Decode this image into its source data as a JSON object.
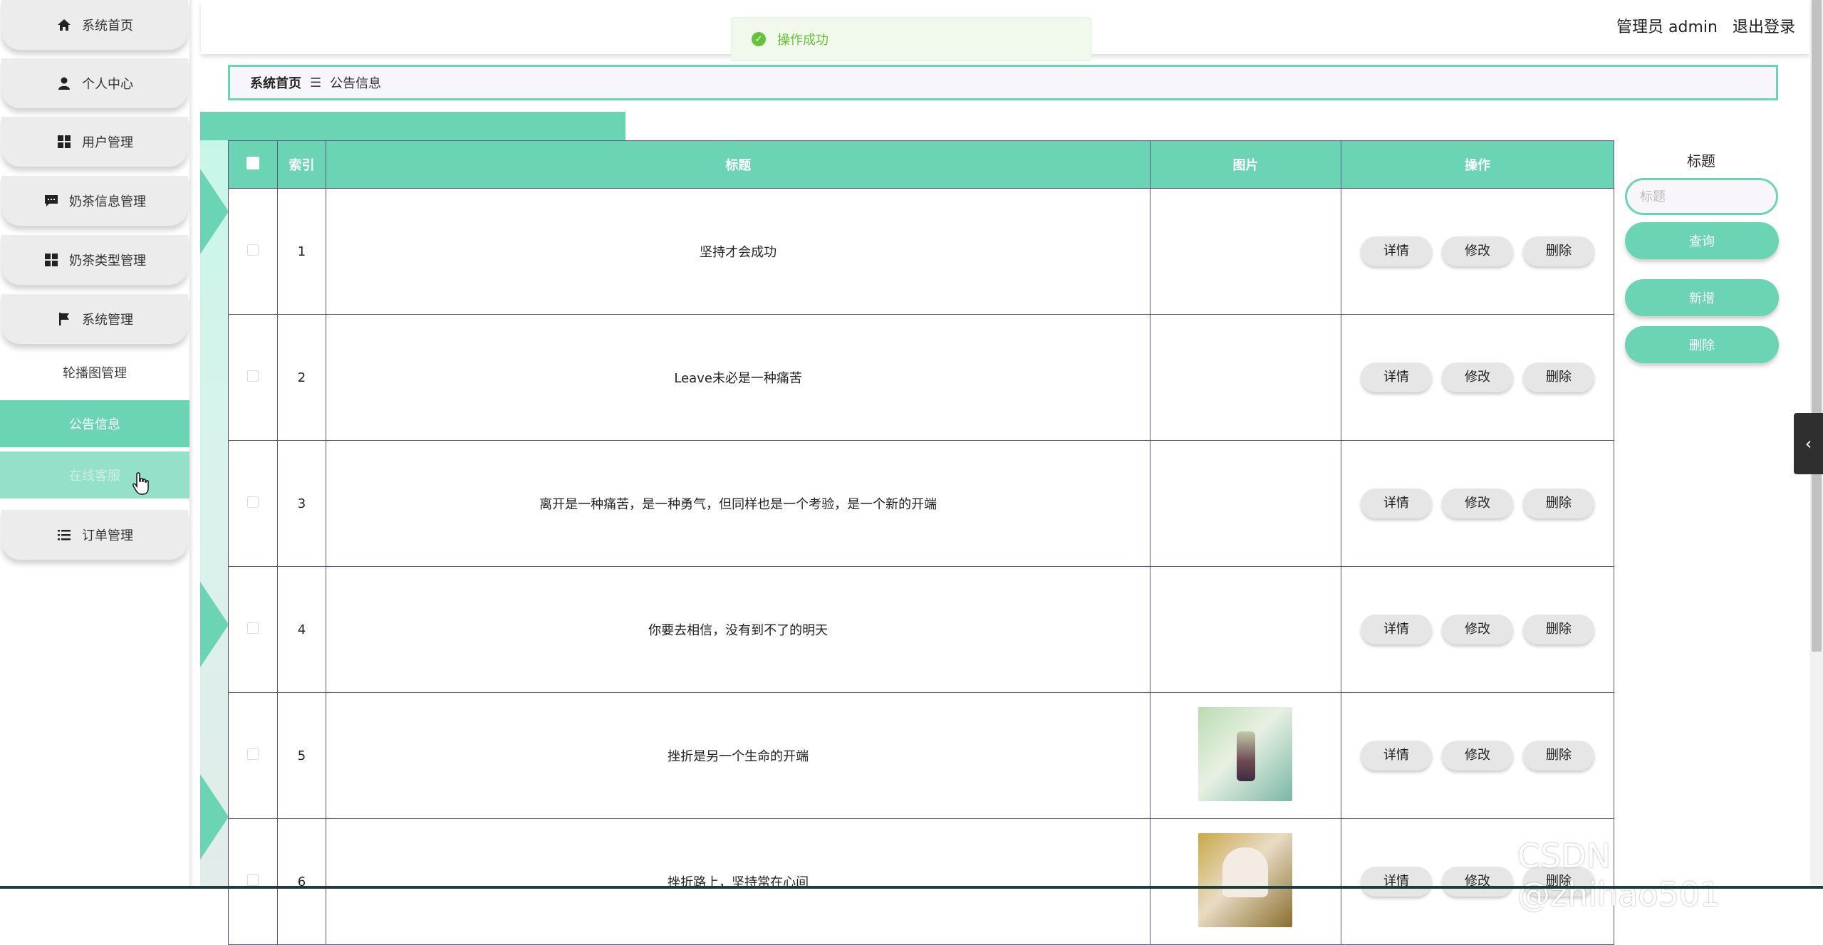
{
  "sidebar": {
    "items": [
      {
        "label": "系统首页",
        "icon": "home-icon"
      },
      {
        "label": "个人中心",
        "icon": "user-icon"
      },
      {
        "label": "用户管理",
        "icon": "grid-icon"
      },
      {
        "label": "奶茶信息管理",
        "icon": "message-icon"
      },
      {
        "label": "奶茶类型管理",
        "icon": "grid-icon"
      },
      {
        "label": "系统管理",
        "icon": "flag-icon"
      }
    ],
    "sub_items": [
      "轮播图管理",
      "公告信息",
      "在线客服"
    ],
    "last_item": {
      "label": "订单管理",
      "icon": "list-icon"
    }
  },
  "header": {
    "role": "管理员 admin",
    "logout": "退出登录"
  },
  "toast": {
    "message": "操作成功"
  },
  "breadcrumb": {
    "home": "系统首页",
    "separator": "☰",
    "current": "公告信息"
  },
  "table": {
    "columns": [
      "索引",
      "标题",
      "图片",
      "操作"
    ],
    "actions": [
      "详情",
      "修改",
      "删除"
    ],
    "rows": [
      {
        "index": "1",
        "title": "坚持才会成功",
        "image": ""
      },
      {
        "index": "2",
        "title": "Leave未必是一种痛苦",
        "image": ""
      },
      {
        "index": "3",
        "title": "离开是一种痛苦，是一种勇气，但同样也是一个考验，是一个新的开端",
        "image": ""
      },
      {
        "index": "4",
        "title": "你要去相信，没有到不了的明天",
        "image": ""
      },
      {
        "index": "5",
        "title": "挫折是另一个生命的开端",
        "image": "drink-photo-1"
      },
      {
        "index": "6",
        "title": "挫折路上，坚持常在心间",
        "image": "drink-photo-2"
      }
    ]
  },
  "search": {
    "label": "标题",
    "placeholder": "标题",
    "query_button": "查询",
    "add_button": "新增",
    "delete_button": "删除"
  },
  "watermark": "CSDN @zhihao501",
  "colors": {
    "accent": "#6bd4b4",
    "toast_green": "#67c23a"
  }
}
